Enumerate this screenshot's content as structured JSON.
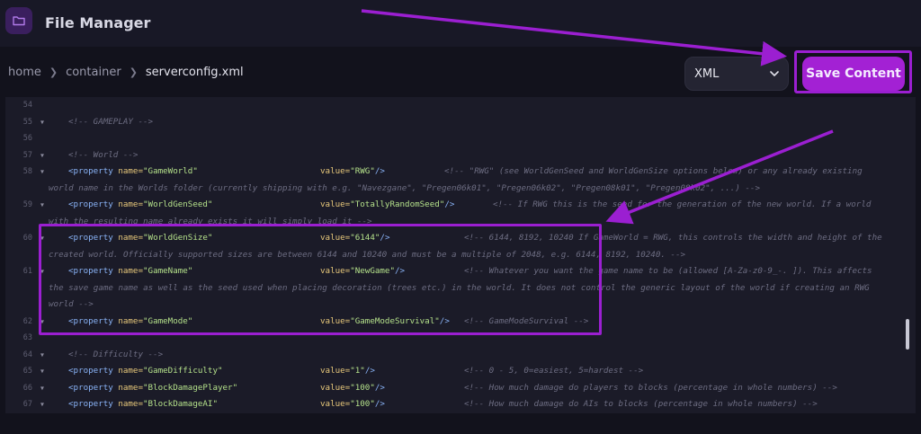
{
  "app": {
    "title": "File Manager",
    "icon": "folder-icon"
  },
  "breadcrumb": {
    "items": [
      "home",
      "container"
    ],
    "current": "serverconfig.xml"
  },
  "toolbar": {
    "language": "XML",
    "save_label": "Save Content"
  },
  "colors": {
    "accent": "#a321d4",
    "highlight": "#9b1fd1",
    "background": "#12121c"
  },
  "editor": {
    "lines": [
      {
        "n": "54",
        "fold": false,
        "parts": []
      },
      {
        "n": "55",
        "fold": true,
        "parts": [
          {
            "t": "cmt",
            "v": "<!-- GAMEPLAY -->"
          }
        ]
      },
      {
        "n": "56",
        "fold": false,
        "parts": []
      },
      {
        "n": "57",
        "fold": true,
        "parts": [
          {
            "t": "cmt",
            "v": "<!-- World -->"
          }
        ]
      },
      {
        "n": "58",
        "fold": true,
        "prop": "GameWorld",
        "value": "RWG",
        "comment": "<!-- \"RWG\" (see WorldGenSeed and WorldGenSize options below) or any already existing",
        "cont": "world name in the Worlds folder (currently shipping with e.g. \"Navezgane\", \"Pregen06k01\", \"Pregen06k02\", \"Pregen08k01\", \"Pregen08k02\", ...) -->"
      },
      {
        "n": "59",
        "fold": true,
        "prop": "WorldGenSeed",
        "value": "TotallyRandomSeed",
        "comment": "<!-- If RWG this is the seed for the generation of the new world. If a world",
        "cont": "with the resulting name already exists it will simply load it -->"
      },
      {
        "n": "60",
        "fold": true,
        "prop": "WorldGenSize",
        "value": "6144",
        "comment": "<!-- 6144, 8192, 10240 If GameWorld = RWG, this controls the width and height of the",
        "cont": "created world. Officially supported sizes are between 6144 and 10240 and must be a multiple of 2048, e.g. 6144, 8192, 10240. -->"
      },
      {
        "n": "61",
        "fold": true,
        "prop": "GameName",
        "value": "NewGame",
        "comment": "<!-- Whatever you want the game name to be (allowed [A-Za-z0-9_-. ]). This affects",
        "cont": "the save game name as well as the seed used when placing decoration (trees etc.) in the world. It does not control the generic layout of the world if creating an RWG",
        "cont2": "world -->"
      },
      {
        "n": "62",
        "fold": true,
        "prop": "GameMode",
        "value": "GameModeSurvival",
        "comment": "<!-- GameModeSurvival -->"
      },
      {
        "n": "63",
        "fold": false,
        "parts": []
      },
      {
        "n": "64",
        "fold": true,
        "parts": [
          {
            "t": "cmt",
            "v": "<!-- Difficulty -->"
          }
        ]
      },
      {
        "n": "65",
        "fold": true,
        "prop": "GameDifficulty",
        "value": "1",
        "comment": "<!-- 0 - 5, 0=easiest, 5=hardest -->"
      },
      {
        "n": "66",
        "fold": true,
        "prop": "BlockDamagePlayer",
        "value": "100",
        "comment": "<!-- How much damage do players to blocks (percentage in whole numbers) -->"
      },
      {
        "n": "67",
        "fold": true,
        "prop": "BlockDamageAI",
        "value": "100",
        "comment": "<!-- How much damage do AIs to blocks (percentage in whole numbers) -->"
      }
    ]
  }
}
